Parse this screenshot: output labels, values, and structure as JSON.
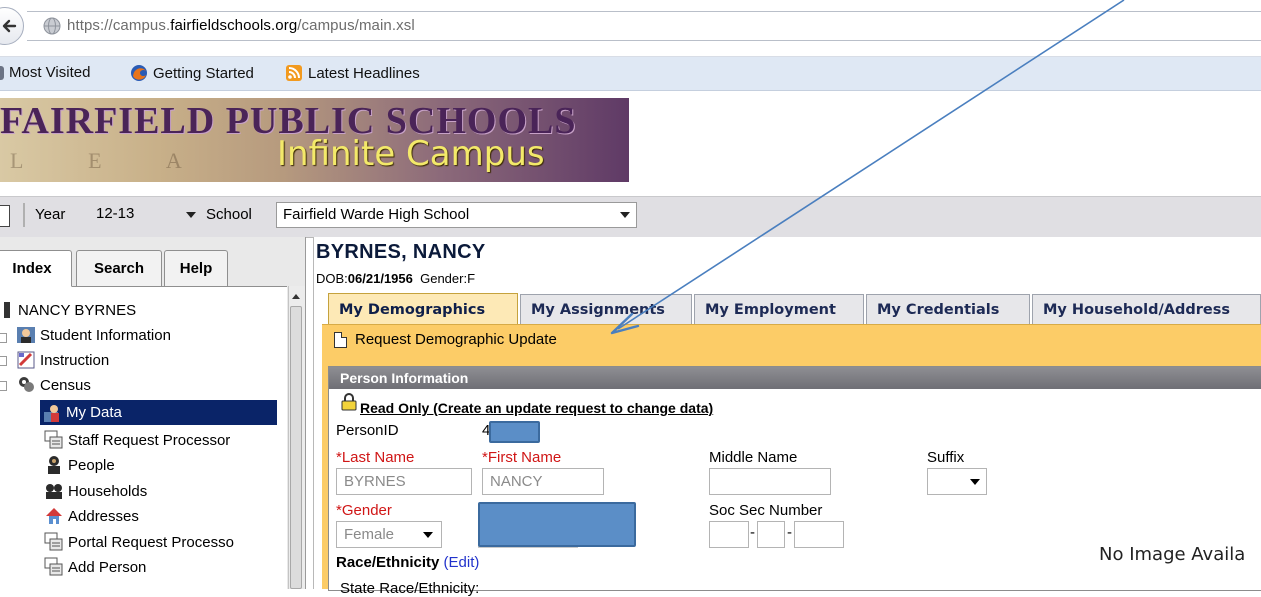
{
  "browser": {
    "url_prefix": "https://campus.",
    "url_domain": "fairfieldschools.org",
    "url_path": "/campus/main.xsl",
    "bookmarks": [
      {
        "label": "Most Visited",
        "icon": "gear-icon"
      },
      {
        "label": "Getting Started",
        "icon": "firefox-icon"
      },
      {
        "label": "Latest Headlines",
        "icon": "rss-icon"
      }
    ]
  },
  "banner": {
    "title": "FAIRFIELD PUBLIC SCHOOLS",
    "subtitle": "Infinite Campus",
    "letters": "L E A"
  },
  "toolbar": {
    "year_label": "Year",
    "year_value": "12-13",
    "school_label": "School",
    "school_value": "Fairfield Warde High School"
  },
  "left_tabs": [
    "Index",
    "Search",
    "Help"
  ],
  "tree": {
    "root": "NANCY BYRNES",
    "items": [
      {
        "label": "Student Information",
        "icon": "student-icon"
      },
      {
        "label": "Instruction",
        "icon": "instruction-icon"
      },
      {
        "label": "Census",
        "icon": "census-icon"
      },
      {
        "label": "My Data",
        "icon": "my-data-icon"
      },
      {
        "label": "Staff Request Processor",
        "icon": "processor-icon"
      },
      {
        "label": "People",
        "icon": "people-icon"
      },
      {
        "label": "Households",
        "icon": "households-icon"
      },
      {
        "label": "Addresses",
        "icon": "addresses-icon"
      },
      {
        "label": "Portal Request Processo",
        "icon": "processor-icon"
      },
      {
        "label": "Add Person",
        "icon": "processor-icon"
      }
    ]
  },
  "person": {
    "name": "BYRNES, NANCY",
    "dob_label": "DOB:",
    "dob": "06/21/1956",
    "gender_label": "Gender:",
    "gender": "F"
  },
  "main_tabs": [
    "My Demographics",
    "My Assignments",
    "My Employment",
    "My Credentials",
    "My Household/Address"
  ],
  "action": {
    "request_label": "Request Demographic Update"
  },
  "form": {
    "section_title": "Person Information",
    "read_only": "Read Only (Create an update request to change data)",
    "person_id_label": "PersonID",
    "person_id_prefix": "4",
    "last_name_label": "*Last Name",
    "last_name_value": "BYRNES",
    "first_name_label": "*First Name",
    "first_name_value": "NANCY",
    "middle_name_label": "Middle Name",
    "middle_name_value": "",
    "suffix_label": "Suffix",
    "gender_label": "*Gender",
    "gender_value": "Female",
    "ssn_label": "Soc Sec Number",
    "race_label": "Race/Ethnicity",
    "race_edit": "(Edit)",
    "state_race_label": "State Race/Ethnicity:",
    "no_image": "No Image Availa"
  },
  "colors": {
    "action_bar": "#fccc67",
    "selected_row": "#0a2468",
    "required": "#d01616",
    "redaction": "#5b8ec7",
    "annotation_arrow": "#4a7fbf"
  }
}
